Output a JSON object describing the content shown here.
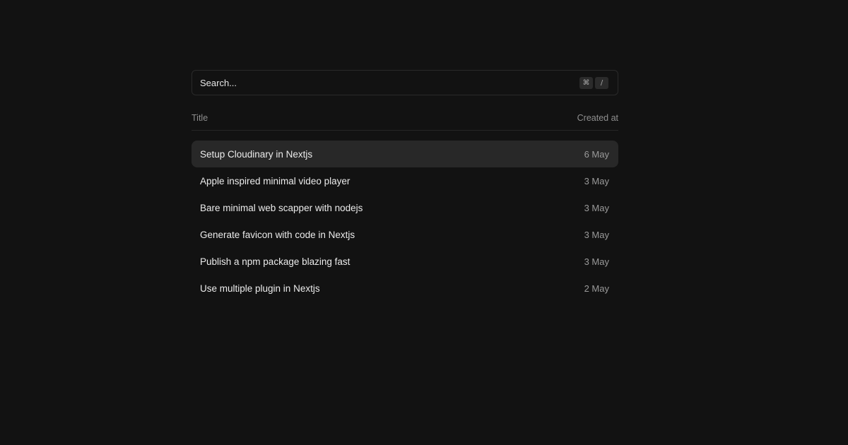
{
  "search": {
    "placeholder": "Search...",
    "shortcut_keys": [
      "⌘",
      "/"
    ]
  },
  "table": {
    "headers": {
      "title": "Title",
      "created_at": "Created at"
    },
    "active_index": 0,
    "rows": [
      {
        "title": "Setup Cloudinary in Nextjs",
        "date": "6 May"
      },
      {
        "title": "Apple inspired minimal video player",
        "date": "3 May"
      },
      {
        "title": "Bare minimal web scapper with nodejs",
        "date": "3 May"
      },
      {
        "title": "Generate favicon with code in Nextjs",
        "date": "3 May"
      },
      {
        "title": "Publish a npm package blazing fast",
        "date": "3 May"
      },
      {
        "title": "Use multiple plugin in Nextjs",
        "date": "2 May"
      }
    ]
  },
  "colors": {
    "background": "#121212",
    "active_row": "#282828",
    "border": "#2a2a2a"
  }
}
